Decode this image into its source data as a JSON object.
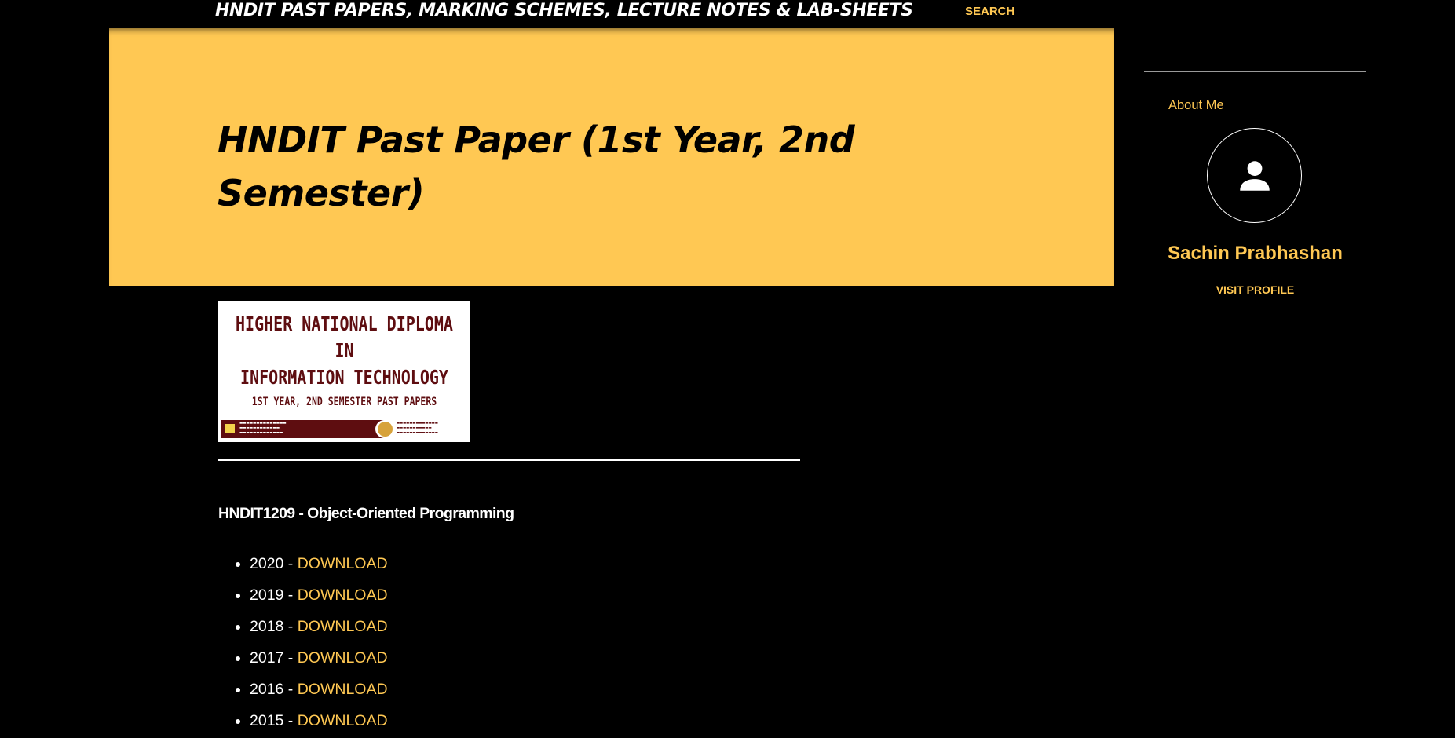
{
  "header": {
    "site_title": "HNDIT PAST PAPERS, MARKING SCHEMES, LECTURE NOTES & LAB-SHEETS",
    "search_label": "SEARCH"
  },
  "post": {
    "title": "HNDIT Past Paper (1st Year, 2nd Semester)",
    "banner": {
      "line1": "HIGHER NATIONAL DIPLOMA",
      "line2": "IN",
      "line3": "INFORMATION TECHNOLOGY",
      "subtitle": "1ST YEAR, 2ND SEMESTER PAST PAPERS"
    },
    "section_heading": "HNDIT1209 - Object-Oriented Programming",
    "papers": [
      {
        "year": "2020 - ",
        "link": "DOWNLOAD"
      },
      {
        "year": "2019 - ",
        "link": "DOWNLOAD"
      },
      {
        "year": "2018 - ",
        "link": "DOWNLOAD"
      },
      {
        "year": "2017 - ",
        "link": "DOWNLOAD"
      },
      {
        "year": "2016 - ",
        "link": "DOWNLOAD"
      },
      {
        "year": "2015 - ",
        "link": "DOWNLOAD"
      }
    ]
  },
  "sidebar": {
    "about_label": "About Me",
    "avatar_icon": "person-icon",
    "profile_name": "Sachin Prabhashan",
    "visit_profile_label": "VISIT PROFILE"
  },
  "colors": {
    "background": "#000000",
    "accent": "#ffc853",
    "text": "#ffffff",
    "banner_maroon": "#5e0d10"
  }
}
